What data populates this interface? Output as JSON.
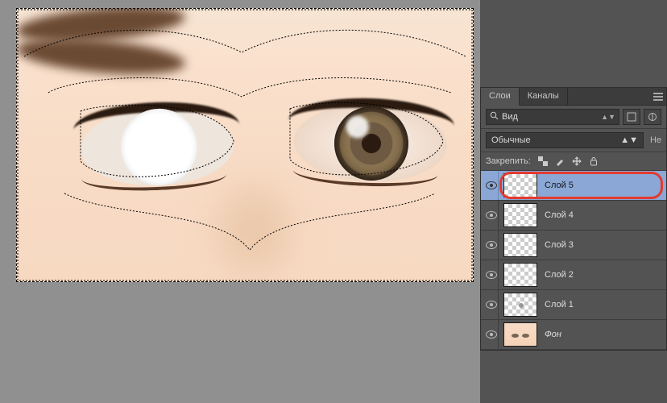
{
  "tabs": {
    "layers": "Слои",
    "channels": "Каналы"
  },
  "filter": {
    "kind_label": "Вид"
  },
  "blend": {
    "mode": "Обычные",
    "opacity_prefix": "Не"
  },
  "lock": {
    "label": "Закрепить:"
  },
  "layers": [
    {
      "name": "Слой 5",
      "selected": true,
      "thumb": "checker",
      "italic": false
    },
    {
      "name": "Слой 4",
      "selected": false,
      "thumb": "checker",
      "italic": false
    },
    {
      "name": "Слой 3",
      "selected": false,
      "thumb": "checker",
      "italic": false
    },
    {
      "name": "Слой 2",
      "selected": false,
      "thumb": "checker",
      "italic": false
    },
    {
      "name": "Слой 1",
      "selected": false,
      "thumb": "checker-dot",
      "italic": false
    },
    {
      "name": "Фон",
      "selected": false,
      "thumb": "face",
      "italic": true
    }
  ]
}
